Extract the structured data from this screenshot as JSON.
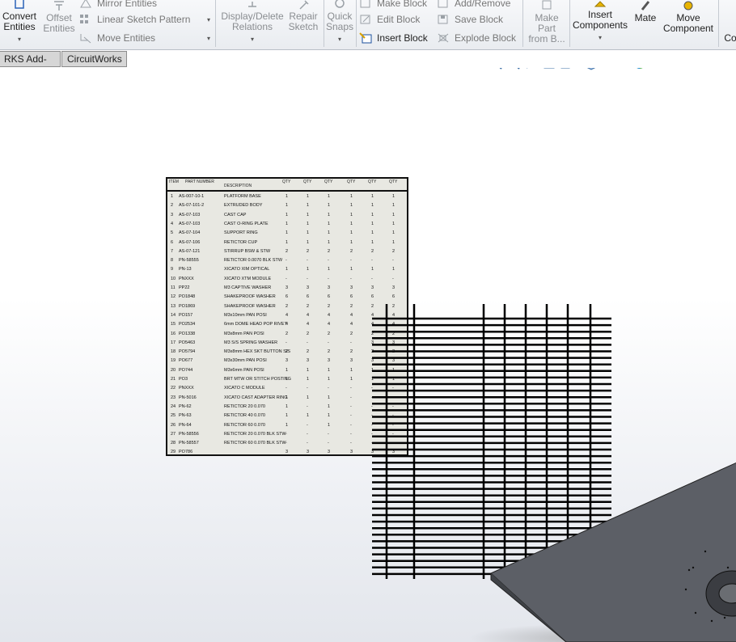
{
  "ribbon": {
    "convert_entities": "Convert\nEntities",
    "offset_entities": "Offset\nEntities",
    "mirror_entities": "Mirror Entities",
    "linear_sketch_pattern": "Linear Sketch Pattern",
    "move_entities": "Move Entities",
    "display_delete_relations": "Display/Delete\nRelations",
    "repair_sketch": "Repair\nSketch",
    "quick_snaps": "Quick\nSnaps",
    "make_block": "Make Block",
    "edit_block": "Edit Block",
    "insert_block": "Insert Block",
    "add_remove": "Add/Remove",
    "save_block": "Save Block",
    "explode_block": "Explode Block",
    "make_part_from_block": "Make\nPart\nfrom B...",
    "insert_components": "Insert\nComponents",
    "mate": "Mate",
    "move_component": "Move\nComponent",
    "cut_off": "Co"
  },
  "tabs": [
    "RKS Add-Ins",
    "CircuitWorks"
  ],
  "bom": {
    "headers": [
      "ITEM",
      "PART NUMBER",
      "DESCRIPTION",
      "QTY",
      "QTY",
      "QTY",
      "QTY",
      "QTY",
      "QTY"
    ],
    "rows": [
      [
        "1",
        "AS-007-10-1",
        "PLATFORM BASE",
        "1",
        "1",
        "1",
        "1",
        "1",
        "1"
      ],
      [
        "2",
        "AS-07-101-2",
        "EXTRUDED BODY",
        "1",
        "1",
        "1",
        "1",
        "1",
        "1"
      ],
      [
        "3",
        "AS-07-103",
        "CAST CAP",
        "1",
        "1",
        "1",
        "1",
        "1",
        "1"
      ],
      [
        "4",
        "AS-07-103",
        "CAST O-RING PLATE",
        "1",
        "1",
        "1",
        "1",
        "1",
        "1"
      ],
      [
        "5",
        "AS-07-104",
        "SUPPORT RING",
        "1",
        "1",
        "1",
        "1",
        "1",
        "1"
      ],
      [
        "6",
        "AS-07-106",
        "RETICTOR CUP",
        "1",
        "1",
        "1",
        "1",
        "1",
        "1"
      ],
      [
        "7",
        "AS-07-121",
        "STIRRUP BSW & STW",
        "2",
        "2",
        "2",
        "2",
        "2",
        "2"
      ],
      [
        "8",
        "PN-58555",
        "RETICTOR 0.0070 BLK STW",
        "-",
        "-",
        "-",
        "-",
        "-",
        "-"
      ],
      [
        "9",
        "PN-13",
        "XICATO XIM OPTICAL",
        "1",
        "1",
        "1",
        "1",
        "1",
        "1"
      ],
      [
        "10",
        "PNXXX",
        "XICATO XTM MODULE",
        "-",
        "-",
        "-",
        "-",
        "-",
        "-"
      ],
      [
        "11",
        "PP22",
        "M3 CAPTIVE WASHER",
        "3",
        "3",
        "3",
        "3",
        "3",
        "3"
      ],
      [
        "12",
        "PO1848",
        "SHAKEPROOF WASHER",
        "6",
        "6",
        "6",
        "6",
        "6",
        "6"
      ],
      [
        "13",
        "PO1869",
        "SHAKEPROOF WASHER",
        "2",
        "2",
        "2",
        "2",
        "2",
        "2"
      ],
      [
        "14",
        "PO157",
        "M3x10mm PAN POSI",
        "4",
        "4",
        "4",
        "4",
        "4",
        "4"
      ],
      [
        "15",
        "PO2534",
        "6mm DOME HEAD POP RIVET",
        "4",
        "4",
        "4",
        "4",
        "4",
        "4"
      ],
      [
        "16",
        "PO1338",
        "M3x8mm PAN POSI",
        "2",
        "2",
        "2",
        "2",
        "2",
        "2"
      ],
      [
        "17",
        "PO5463",
        "M3 S/S SPRING WASHER",
        "-",
        "-",
        "-",
        "-",
        "3",
        "3"
      ],
      [
        "18",
        "PO5794",
        "M3x8mm HEX SKT BUTTON S/S",
        "2",
        "2",
        "2",
        "2",
        "2",
        "2"
      ],
      [
        "19",
        "PO677",
        "M3x30mm PAN POSI",
        "3",
        "3",
        "3",
        "3",
        "3",
        "3"
      ],
      [
        "20",
        "PO744",
        "M3x6mm PAN POSI",
        "1",
        "1",
        "1",
        "1",
        "1",
        "1"
      ],
      [
        "21",
        "PO3",
        "BRT MTW OR STITCH POSTING",
        "1",
        "1",
        "1",
        "1",
        "1",
        "1"
      ],
      [
        "22",
        "PNXXX",
        "XICATO C MODULE",
        "-",
        "-",
        "-",
        "-",
        "-",
        "-"
      ],
      [
        "23",
        "PN-5016",
        "XICATO CAST ADAPTER RING",
        "1",
        "1",
        "1",
        "-",
        "-",
        "-"
      ],
      [
        "24",
        "PN-62",
        "RETICTOR 20 0.070",
        "1",
        "-",
        "1",
        "-",
        "-",
        "-"
      ],
      [
        "25",
        "PN-63",
        "RETICTOR 40 0.070",
        "1",
        "1",
        "1",
        "-",
        "-",
        "-"
      ],
      [
        "26",
        "PN-64",
        "RETICTOR 60 0.070",
        "1",
        "-",
        "1",
        "-",
        "-",
        "-"
      ],
      [
        "27",
        "PN-58556",
        "RETICTOR 20 0.070 BLK STW",
        "-",
        "-",
        "-",
        "-",
        "-",
        "-"
      ],
      [
        "28",
        "PN-58557",
        "RETICTOR 60 0.070 BLK STW",
        "-",
        "-",
        "-",
        "-",
        "-",
        "-"
      ],
      [
        "29",
        "PO786",
        "",
        "3",
        "3",
        "3",
        "3",
        "3",
        "3"
      ]
    ]
  },
  "colors": {
    "ribbon_bg": "#eceff2",
    "tab_bg": "#d6d6d6",
    "plate": "#5a5d63",
    "bom_bg": "#e8e8e2"
  }
}
